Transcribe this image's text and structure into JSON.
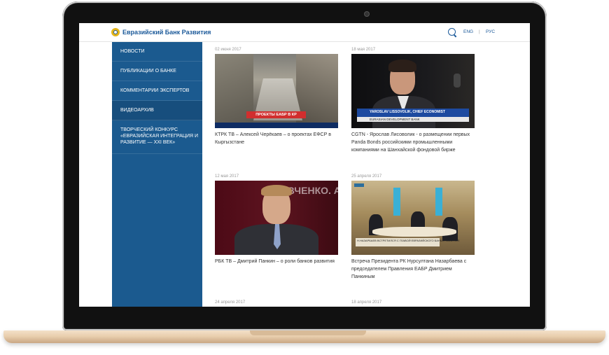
{
  "header": {
    "logo_text": "Евразийский Банк Развития",
    "lang_eng": "ENG",
    "lang_sep": "|",
    "lang_rus": "РУС"
  },
  "sidebar": {
    "items": [
      {
        "label": "Новости"
      },
      {
        "label": "Публикации о банке"
      },
      {
        "label": "Комментарии экспертов"
      },
      {
        "label": "Видеоархив"
      },
      {
        "label": "Творческий конкурс «Евразийская интеграция и развитие — XXI век»"
      }
    ]
  },
  "videos": [
    {
      "date": "02 июня 2017",
      "title": "КТРК ТВ – Алексей Черёкаев – о проектах ЕФСР в Кыргызстане",
      "overlay": "ПРОЕКТЫ ЕАБР В КР"
    },
    {
      "date": "18 мая 2017",
      "title": "CGTN - Ярослав Лисоволик - о размещении первых Panda Bonds российскими промышленными компаниями на Шанхайской фондовой бирже",
      "overlay_name": "YAROSLAV LISSOVOLIK, CHIEF ECONOMIST",
      "overlay_org": "EURASIAN DEVELOPMENT BANK"
    },
    {
      "date": "12 мая 2017",
      "title": "РБК ТВ – Дмитрий Панкин – о роли банков развития",
      "overlay": "ЫВЧЕНКО. АКУРС"
    },
    {
      "date": "25 апреля 2017",
      "title": "Встреча Президента РК Нурсултана Назарбаева с председателем Правления ЕАБР Дмитрием Панкиным",
      "overlay": "Н.НАЗАРБАЕВ ВСТРЕТИЛСЯ С ГЛАВОЙ ЕВРАЗИЙСКОГО БАНКА РАЗВИТИЯ"
    },
    {
      "date": "24 апреля 2017"
    },
    {
      "date": "18 апреля 2017"
    }
  ]
}
